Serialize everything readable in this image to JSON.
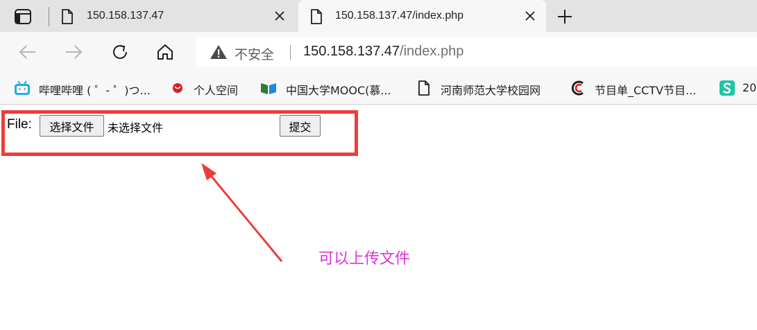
{
  "tabs": [
    {
      "title": "150.158.137.47",
      "active": false
    },
    {
      "title": "150.158.137.47/index.php",
      "active": true
    }
  ],
  "toolbar": {
    "security_label": "不安全",
    "url_host": "150.158.137.47",
    "url_path": "/index.php"
  },
  "bookmarks": [
    {
      "label": "哔哩哔哩 ( ゜- ゜)つ...",
      "icon": "bilibili-icon"
    },
    {
      "label": "个人空间",
      "icon": "red-ball-icon"
    },
    {
      "label": "中国大学MOOC(慕...",
      "icon": "mooc-book-icon"
    },
    {
      "label": "河南师范大学校园网",
      "icon": "page-icon"
    },
    {
      "label": "节目单_CCTV节目...",
      "icon": "cctv-icon"
    },
    {
      "label": "20",
      "icon": "green-s-icon"
    }
  ],
  "form": {
    "file_label": "File:",
    "choose_button": "选择文件",
    "no_file_text": "未选择文件",
    "submit_button": "提交"
  },
  "annotation": {
    "caption": "可以上传文件",
    "box_color": "#ef3b3b",
    "caption_color": "#e030d8"
  }
}
